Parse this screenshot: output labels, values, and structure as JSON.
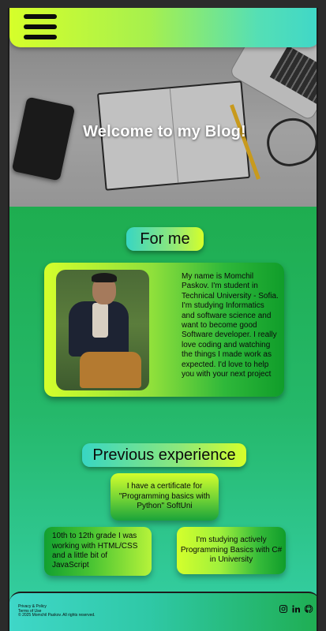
{
  "header": {
    "menu_icon": "hamburger-menu-icon"
  },
  "hero": {
    "title": "Welcome to my Blog!"
  },
  "about": {
    "heading": "For me",
    "text": "My name is Momchil Paskov. I'm student in Technical University - Sofia. I'm studying Informatics and software science and want to become good Software developer. I really love coding and watching the things I made work as expected. I'd love to help you with your next project"
  },
  "experience": {
    "heading": "Previous experience",
    "items": [
      "I have a certificate for \"Programming basics with Python\" SoftUni",
      "10th to 12th grade I was working with HTML/CSS and a little bit of JavaScript",
      "I'm studying actively Programming Basics with C# in University"
    ]
  },
  "footer": {
    "privacy": "Privacy & Policy",
    "terms": "Terms of Use",
    "copyright": "© 2025 Momchil Paskov. All rights reserved.",
    "social_icons": [
      "instagram-icon",
      "linkedin-icon",
      "github-icon"
    ]
  },
  "colors": {
    "accent_lime": "#d6ff2a",
    "accent_teal": "#3fd7c8",
    "green": "#15a33a"
  }
}
